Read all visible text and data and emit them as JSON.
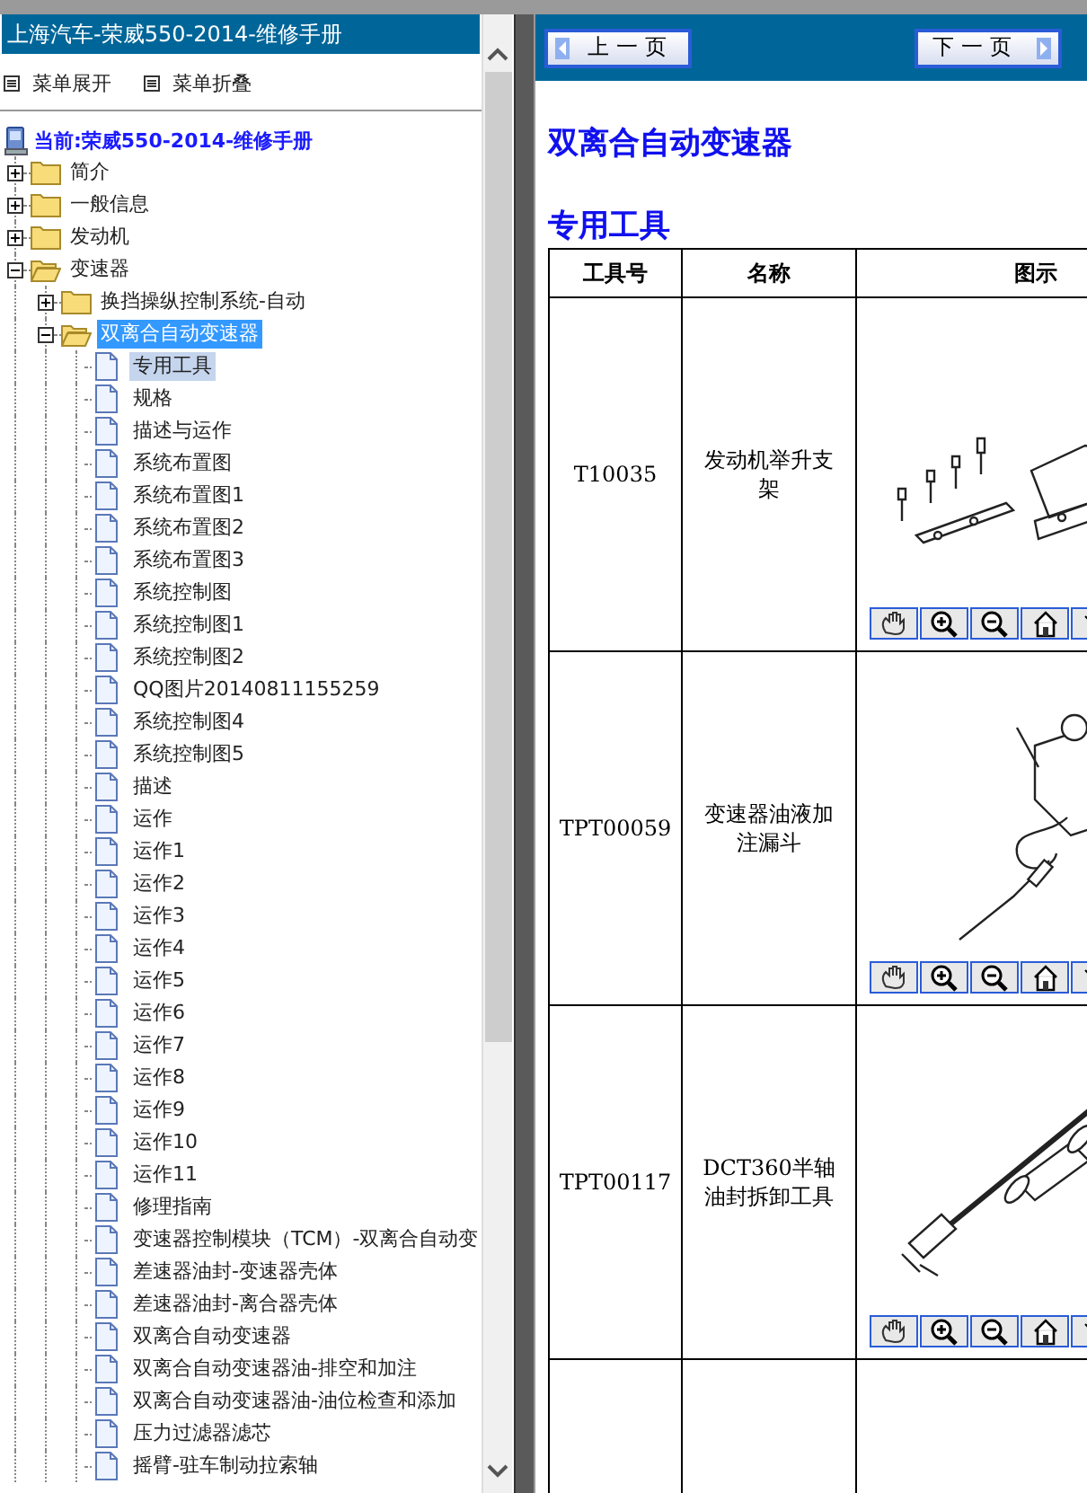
{
  "header": {
    "title": "上海汽车-荣威550-2014-维修手册"
  },
  "menu_actions": [
    {
      "label": "菜单展开"
    },
    {
      "label": "菜单折叠"
    }
  ],
  "tree": {
    "root": "当前:荣威550-2014-维修手册",
    "items": [
      {
        "label": "简介",
        "kind": "folder",
        "expanded": false,
        "selected": false
      },
      {
        "label": "一般信息",
        "kind": "folder",
        "expanded": false,
        "selected": false
      },
      {
        "label": "发动机",
        "kind": "folder",
        "expanded": false,
        "selected": false
      },
      {
        "label": "变速器",
        "kind": "folder",
        "expanded": true,
        "selected": false,
        "children": [
          {
            "label": "换挡操纵控制系统-自动",
            "kind": "folder",
            "expanded": false,
            "selected": false
          },
          {
            "label": "双离合自动变速器",
            "kind": "folder",
            "expanded": true,
            "selected": true,
            "children": [
              {
                "label": "专用工具",
                "kind": "page",
                "selected": true
              },
              {
                "label": "规格",
                "kind": "page",
                "selected": false
              },
              {
                "label": "描述与运作",
                "kind": "page",
                "selected": false
              },
              {
                "label": "系统布置图",
                "kind": "page",
                "selected": false
              },
              {
                "label": "系统布置图1",
                "kind": "page",
                "selected": false
              },
              {
                "label": "系统布置图2",
                "kind": "page",
                "selected": false
              },
              {
                "label": "系统布置图3",
                "kind": "page",
                "selected": false
              },
              {
                "label": "系统控制图",
                "kind": "page",
                "selected": false
              },
              {
                "label": "系统控制图1",
                "kind": "page",
                "selected": false
              },
              {
                "label": "系统控制图2",
                "kind": "page",
                "selected": false
              },
              {
                "label": "QQ图片20140811155259",
                "kind": "page",
                "selected": false
              },
              {
                "label": "系统控制图4",
                "kind": "page",
                "selected": false
              },
              {
                "label": "系统控制图5",
                "kind": "page",
                "selected": false
              },
              {
                "label": "描述",
                "kind": "page",
                "selected": false
              },
              {
                "label": "运作",
                "kind": "page",
                "selected": false
              },
              {
                "label": "运作1",
                "kind": "page",
                "selected": false
              },
              {
                "label": "运作2",
                "kind": "page",
                "selected": false
              },
              {
                "label": "运作3",
                "kind": "page",
                "selected": false
              },
              {
                "label": "运作4",
                "kind": "page",
                "selected": false
              },
              {
                "label": "运作5",
                "kind": "page",
                "selected": false
              },
              {
                "label": "运作6",
                "kind": "page",
                "selected": false
              },
              {
                "label": "运作7",
                "kind": "page",
                "selected": false
              },
              {
                "label": "运作8",
                "kind": "page",
                "selected": false
              },
              {
                "label": "运作9",
                "kind": "page",
                "selected": false
              },
              {
                "label": "运作10",
                "kind": "page",
                "selected": false
              },
              {
                "label": "运作11",
                "kind": "page",
                "selected": false
              },
              {
                "label": "修理指南",
                "kind": "page",
                "selected": false
              },
              {
                "label": "变速器控制模块（TCM）-双离合自动变",
                "kind": "page",
                "selected": false
              },
              {
                "label": "差速器油封-变速器壳体",
                "kind": "page",
                "selected": false
              },
              {
                "label": "差速器油封-离合器壳体",
                "kind": "page",
                "selected": false
              },
              {
                "label": "双离合自动变速器",
                "kind": "page",
                "selected": false
              },
              {
                "label": "双离合自动变速器油-排空和加注",
                "kind": "page",
                "selected": false
              },
              {
                "label": "双离合自动变速器油-油位检查和添加",
                "kind": "page",
                "selected": false
              },
              {
                "label": "压力过滤器滤芯",
                "kind": "page",
                "selected": false
              },
              {
                "label": "摇臂-驻车制动拉索轴",
                "kind": "page",
                "selected": false
              }
            ]
          }
        ]
      }
    ]
  },
  "nav": {
    "prev": "上一页",
    "next": "下一页"
  },
  "headings": [
    "双离合自动变速器",
    "专用工具"
  ],
  "table": {
    "columns": [
      "工具号",
      "名称",
      "图示"
    ],
    "rows": [
      {
        "tool_no": "T10035",
        "name": "发动机举升支架"
      },
      {
        "tool_no": "TPT00059",
        "name": "变速器油液加注漏斗"
      },
      {
        "tool_no": "TPT00117",
        "name": "DCT360半轴油封拆卸工具"
      }
    ]
  }
}
